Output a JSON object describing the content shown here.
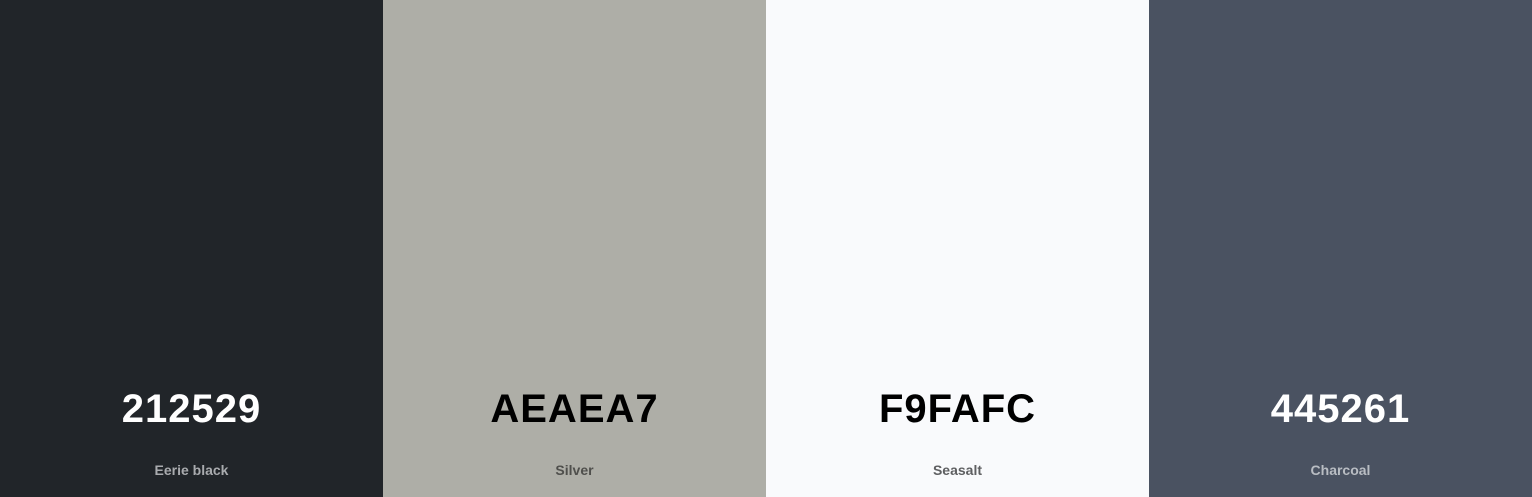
{
  "palette": {
    "swatches": [
      {
        "hex": "212529",
        "name": "Eerie black",
        "color": "#212529",
        "hex_color": "#FFFFFF",
        "name_color": "#A9ABAE"
      },
      {
        "hex": "AEAEA7",
        "name": "Silver",
        "color": "#AEAEA7",
        "hex_color": "#000000",
        "name_color": "#4F4F4C"
      },
      {
        "hex": "F9FAFC",
        "name": "Seasalt",
        "color": "#F9FAFC",
        "hex_color": "#000000",
        "name_color": "#5E5F61"
      },
      {
        "hex": "445261",
        "name": "Charcoal",
        "color": "#4A5261",
        "hex_color": "#FFFFFF",
        "name_color": "#B9BDC3"
      }
    ]
  }
}
